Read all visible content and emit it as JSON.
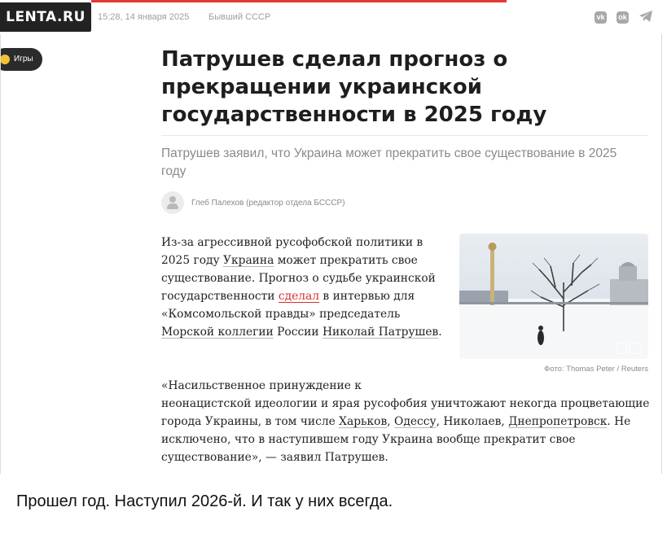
{
  "header": {
    "logo": "LENTA.RU",
    "date": "15:28, 14 января 2025",
    "rubric": "Бывший СССР",
    "share_icons": [
      "vk-icon",
      "ok-icon",
      "telegram-icon"
    ]
  },
  "side": {
    "games_label": "Игры"
  },
  "article": {
    "title": "Патрушев сделал прогноз о прекращении украинской государственности в 2025 году",
    "subtitle": "Патрушев заявил, что Украина может прекратить свое существование в 2025 году",
    "author": "Глеб Палехов (редактор отдела БСССР)",
    "lead": {
      "p1": "Из-за агрессивной русофобской политики в 2025 году ",
      "link1": "Украина",
      "p2": " может прекратить свое существование. Прогноз о судьбе украинской государственности ",
      "link2": "сделал",
      "p3": " в интервью для «Комсомольской правды» председатель ",
      "link3": "Морской коллегии",
      "p4": " России ",
      "link4": "Николай Патрушев",
      "p5": "."
    },
    "photo_caption": "Фото: Thomas Peter / Reuters",
    "quote": {
      "q1": "«Насильственное принуждение к",
      "q2": "неонацистской идеологии и ярая русофобия уничтожают некогда процветающие города Украины, в том числе ",
      "link1": "Харьков",
      "q3": ", ",
      "link2": "Одессу",
      "q4": ", Николаев, ",
      "link3": "Днепропетровск",
      "q5": ". Не исключено, что в наступившем году Украина вообще прекратит свое существование», — заявил Патрушев."
    }
  },
  "comment": "Прошел год. Наступил 2026-й. И так у них всегда.",
  "colors": {
    "accent": "#e53935",
    "link_red": "#d32f2f"
  }
}
